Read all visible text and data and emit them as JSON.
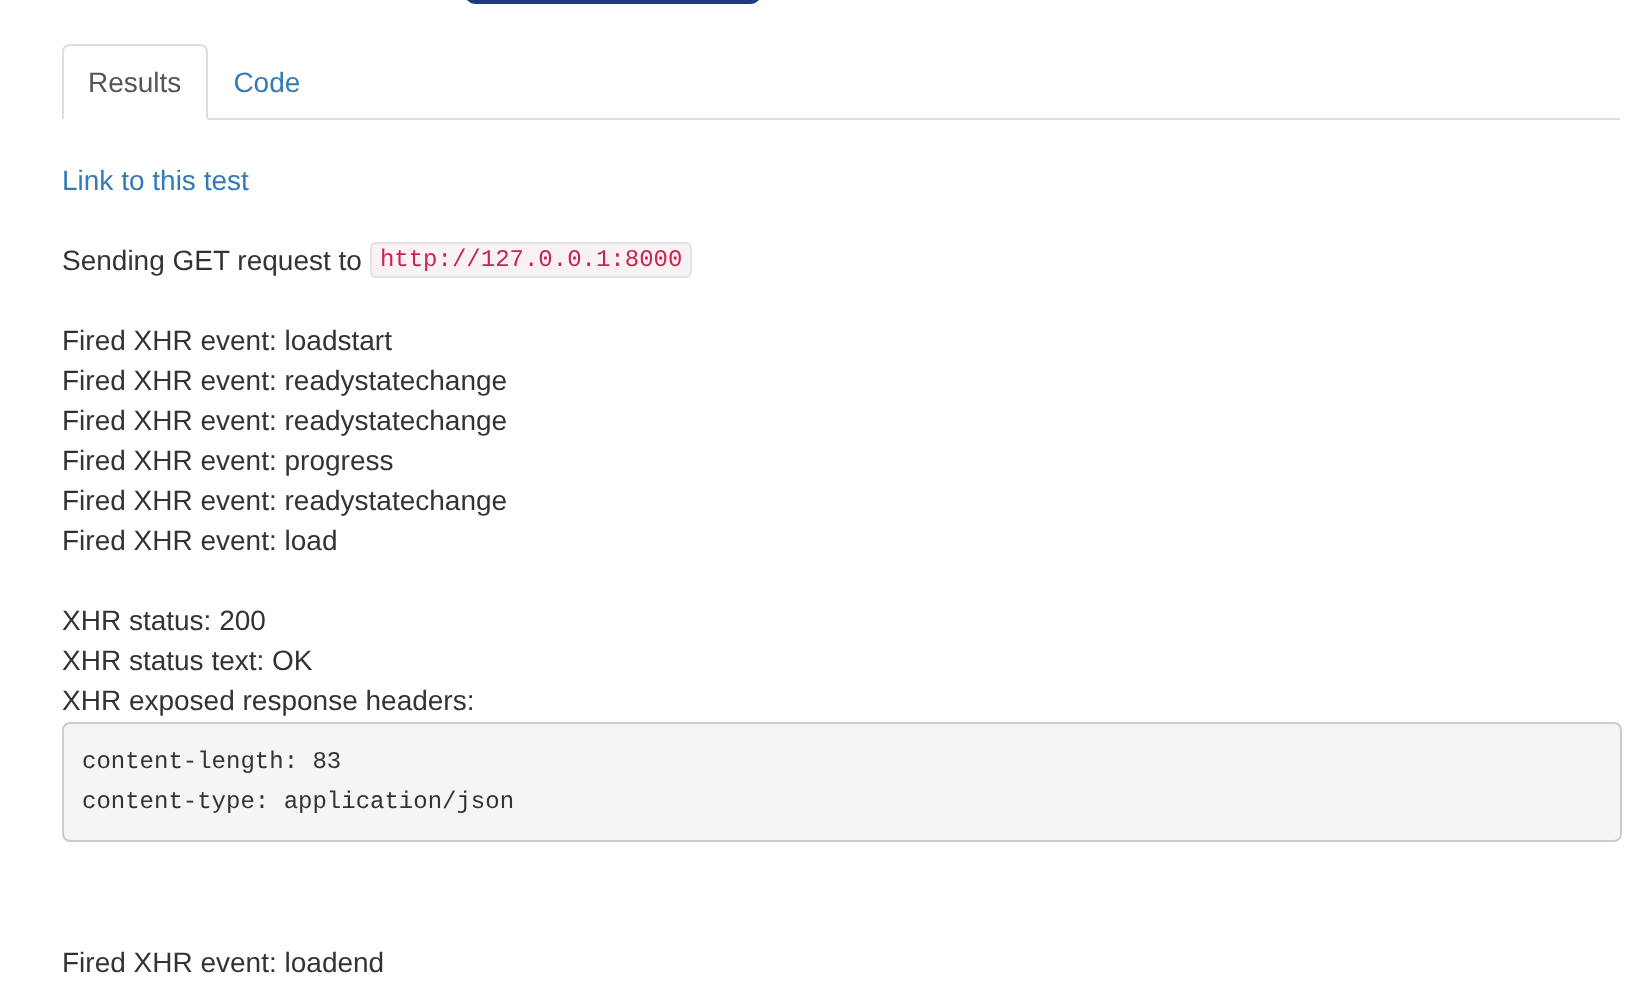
{
  "tabs": [
    {
      "label": "Results",
      "selected": true
    },
    {
      "label": "Code",
      "selected": false
    }
  ],
  "link": "Link to this test",
  "request": {
    "text": "Sending GET request to",
    "url": "http://127.0.0.1:8000"
  },
  "events": [
    "Fired XHR event: loadstart",
    "Fired XHR event: readystatechange",
    "Fired XHR event: readystatechange",
    "Fired XHR event: progress",
    "Fired XHR event: readystatechange",
    "Fired XHR event: load"
  ],
  "status_lines": [
    "XHR status: 200",
    "XHR status text: OK",
    "XHR exposed response headers:"
  ],
  "headers": [
    "content-length: 83",
    "content-type: application/json"
  ],
  "final_event": "Fired XHR event: loadend"
}
